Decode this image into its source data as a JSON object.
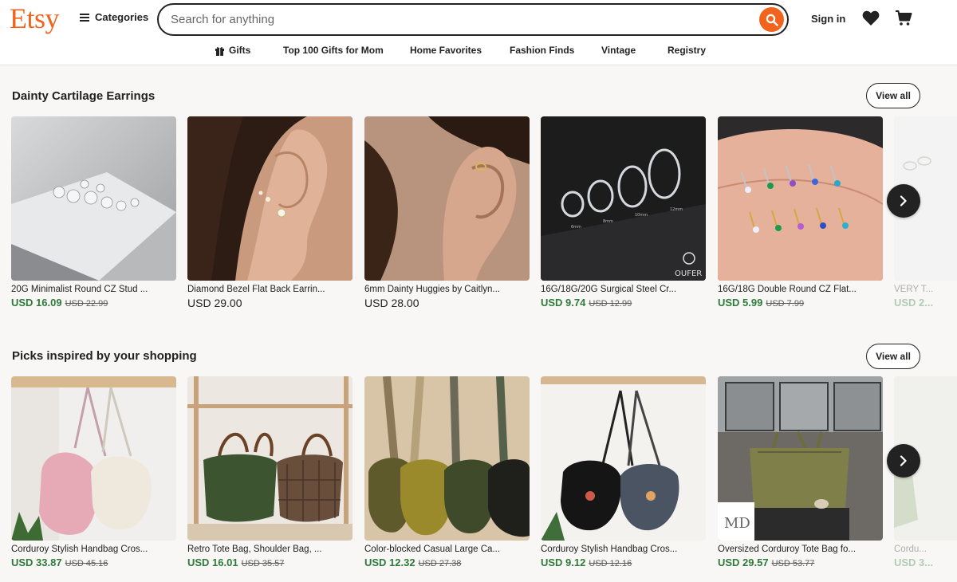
{
  "header": {
    "logo": "Etsy",
    "categories_label": "Categories",
    "search_placeholder": "Search for anything",
    "signin_label": "Sign in"
  },
  "nav": {
    "items": [
      {
        "label": "Gifts"
      },
      {
        "label": "Top 100 Gifts for Mom"
      },
      {
        "label": "Home Favorites"
      },
      {
        "label": "Fashion Finds"
      },
      {
        "label": "Vintage"
      },
      {
        "label": "Registry"
      }
    ]
  },
  "sections": [
    {
      "title": "Dainty Cartilage Earrings",
      "view_all": "View all",
      "items": [
        {
          "title": "20G Minimalist Round CZ Stud ...",
          "price": "USD 16.09",
          "original": "USD 22.99",
          "image": "earring-studs"
        },
        {
          "title": "Diamond Bezel Flat Back Earrin...",
          "price": "USD 29.00",
          "original": "",
          "image": "ear-lobe-studs"
        },
        {
          "title": "6mm Dainty Huggies by Caitlyn...",
          "price": "USD 28.00",
          "original": "",
          "image": "ear-huggie"
        },
        {
          "title": "16G/18G/20G Surgical Steel Cr...",
          "price": "USD 9.74",
          "original": "USD 12.99",
          "image": "steel-hoops",
          "image_text": [
            "6mm",
            "8mm",
            "10mm",
            "12mm",
            "OUFER"
          ]
        },
        {
          "title": "16G/18G Double Round CZ Flat...",
          "price": "USD 5.99",
          "original": "USD 7.99",
          "image": "colored-studs"
        },
        {
          "title": "VERY T...",
          "price": "USD 2...",
          "original": "",
          "image": "partial"
        }
      ]
    },
    {
      "title": "Picks inspired by your shopping",
      "view_all": "View all",
      "items": [
        {
          "title": "Corduroy Stylish Handbag Cros...",
          "price": "USD 33.87",
          "original": "USD 45.16",
          "image": "pink-white-bags"
        },
        {
          "title": "Retro Tote Bag, Shoulder Bag, ...",
          "price": "USD 16.01",
          "original": "USD 35.57",
          "image": "green-plaid-bags"
        },
        {
          "title": "Color-blocked Casual Large Ca...",
          "price": "USD 12.32",
          "original": "USD 27.38",
          "image": "colored-bags"
        },
        {
          "title": "Corduroy Stylish Handbag Cros...",
          "price": "USD 9.12",
          "original": "USD 12.16",
          "image": "black-grey-bags"
        },
        {
          "title": "Oversized Corduroy Tote Bag fo...",
          "price": "USD 29.57",
          "original": "USD 53.77",
          "image": "olive-tote",
          "image_text": [
            "MD"
          ]
        },
        {
          "title": "Cordu...",
          "price": "USD 3...",
          "original": "",
          "image": "partial"
        }
      ]
    }
  ],
  "colors": {
    "brand": "#f1641e",
    "sale_price": "#2f7a3b",
    "background": "#f8f7f5"
  }
}
